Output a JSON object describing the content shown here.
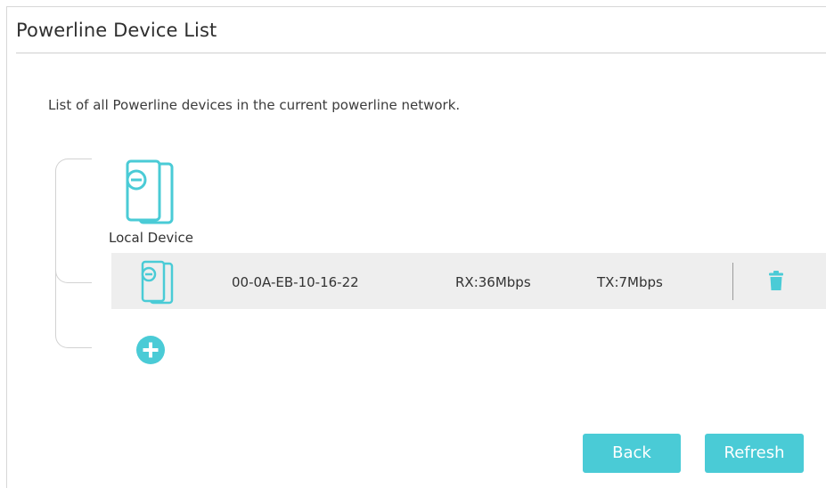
{
  "page": {
    "title": "Powerline Device List",
    "description": "List of all Powerline devices in the current powerline network."
  },
  "local_device": {
    "label": "Local Device",
    "icon": "powerline-adapter-icon"
  },
  "devices": [
    {
      "mac": "00-0A-EB-10-16-22",
      "rx": "RX:36Mbps",
      "tx": "TX:7Mbps",
      "icon": "powerline-adapter-icon",
      "action_icon": "trash-icon"
    }
  ],
  "add_device": {
    "icon": "plus-circle-icon"
  },
  "buttons": {
    "back": "Back",
    "refresh": "Refresh"
  },
  "colors": {
    "accent": "#4acbd6",
    "row_bg": "#eeeeee",
    "text": "#333333"
  }
}
